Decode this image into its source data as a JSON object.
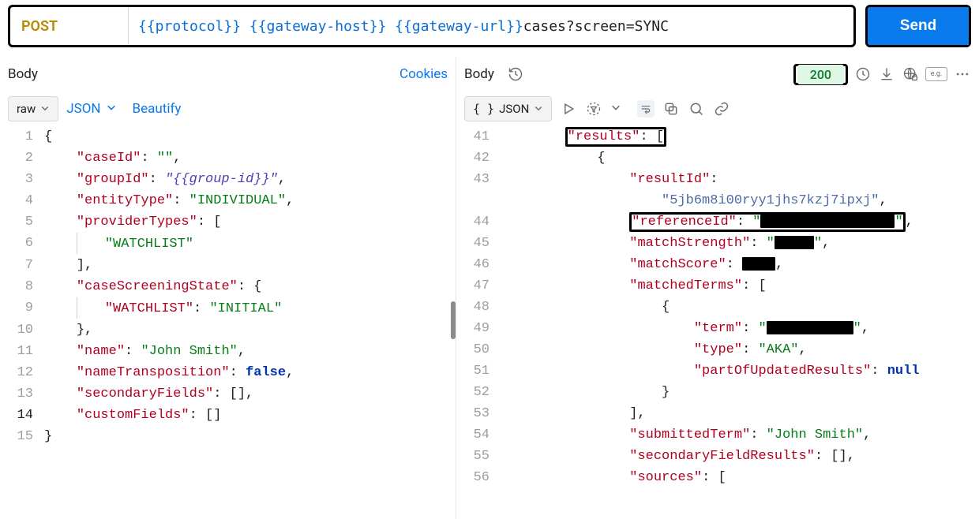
{
  "request": {
    "method": "POST",
    "url_vars": [
      "{{protocol}}",
      "{{gateway-host}}",
      "{{gateway-url}}"
    ],
    "url_suffix": " cases?screen=SYNC",
    "send_label": "Send"
  },
  "left": {
    "tab_label": "Body",
    "cookies_label": "Cookies",
    "raw_label": "raw",
    "json_label": "JSON",
    "beautify_label": "Beautify",
    "body": {
      "caseId": "",
      "groupId_template": "{{group-id}}",
      "entityType": "INDIVIDUAL",
      "providerTypes": [
        "WATCHLIST"
      ],
      "caseScreeningState": {
        "WATCHLIST": "INITIAL"
      },
      "name": "John Smith",
      "nameTransposition": false,
      "secondaryFields": [],
      "customFields": []
    }
  },
  "right": {
    "tab_label": "Body",
    "status": "200",
    "json_select": "JSON",
    "line_start": 41,
    "response_excerpt": {
      "key": "results",
      "resultId_key": "resultId",
      "resultId_value": "5jb6m8i00ryy1jhs7kzj7ipxj",
      "referenceId_key": "referenceId",
      "matchStrength_key": "matchStrength",
      "matchScore_key": "matchScore",
      "matchedTerms_key": "matchedTerms",
      "term_key": "term",
      "type_key": "type",
      "type_value": "AKA",
      "partOfUpdatedResults_key": "partOfUpdatedResults",
      "partOfUpdatedResults_value": "null",
      "submittedTerm_key": "submittedTerm",
      "submittedTerm_value": "John Smith",
      "secondaryFieldResults_key": "secondaryFieldResults",
      "sources_key": "sources"
    }
  }
}
